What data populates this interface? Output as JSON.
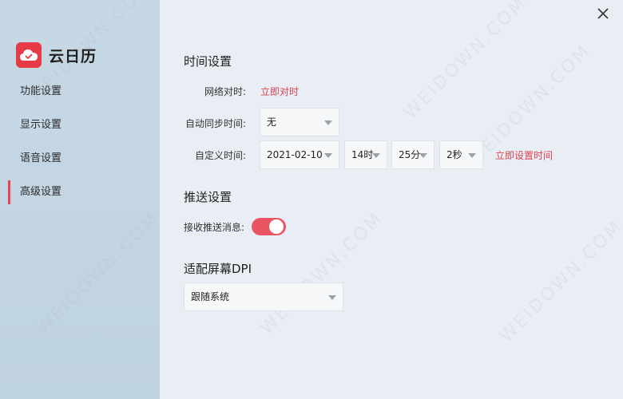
{
  "app": {
    "name": "云日历"
  },
  "sidebar": {
    "items": [
      {
        "label": "功能设置"
      },
      {
        "label": "显示设置"
      },
      {
        "label": "语音设置"
      },
      {
        "label": "高级设置",
        "active": true
      }
    ]
  },
  "time_settings": {
    "title": "时间设置",
    "network_sync": {
      "label": "网络对时:",
      "action": "立即对时"
    },
    "auto_sync": {
      "label": "自动同步时间:",
      "value": "无"
    },
    "custom_time": {
      "label": "自定义时间:",
      "date": "2021-02-10",
      "hour": "14时",
      "minute": "25分",
      "second": "2秒",
      "action": "立即设置时间"
    }
  },
  "push_settings": {
    "title": "推送设置",
    "receive": {
      "label": "接收推送消息:",
      "enabled": true
    }
  },
  "dpi_settings": {
    "title": "适配屏幕DPI",
    "value": "跟随系统"
  },
  "watermark": "WEIDOWN.COM",
  "colors": {
    "accent": "#e54552",
    "sidebar": "#c5d7e4",
    "main": "#e9eef5"
  }
}
